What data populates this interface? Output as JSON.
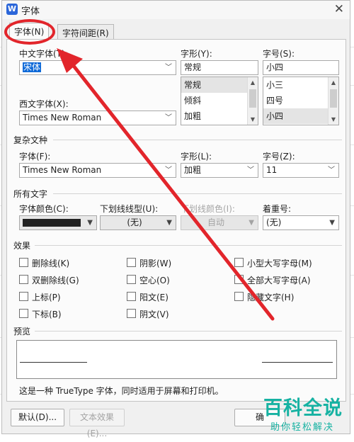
{
  "window": {
    "title": "字体",
    "app_icon_letter": "W",
    "close": "✕"
  },
  "tabs": [
    {
      "label": "字体(N)",
      "active": true
    },
    {
      "label": "字符间距(R)",
      "active": false
    }
  ],
  "chinese_font": {
    "label": "中文字体(T):",
    "value": "宋体"
  },
  "style": {
    "label": "字形(Y):",
    "value": "常规",
    "options": [
      "常规",
      "倾斜",
      "加粗"
    ]
  },
  "size": {
    "label": "字号(S):",
    "value": "小四",
    "options": [
      "小三",
      "四号",
      "小四"
    ]
  },
  "western_font": {
    "label": "西文字体(X):",
    "value": "Times New Roman"
  },
  "complex": {
    "section_label": "复杂文种",
    "font_label": "字体(F):",
    "font_value": "Times New Roman",
    "style_label": "字形(L):",
    "style_value": "加粗",
    "size_label": "字号(Z):",
    "size_value": "11"
  },
  "all_text": {
    "section_label": "所有文字",
    "color_label": "字体颜色(C):",
    "underline_label": "下划线线型(U):",
    "underline_value": "(无)",
    "underline_color_label": "下划线颜色(I):",
    "underline_color_value": "自动",
    "emphasis_label": "着重号:",
    "emphasis_value": "(无)"
  },
  "effects": {
    "section_label": "效果",
    "items": [
      "删除线(K)",
      "双删除线(G)",
      "上标(P)",
      "下标(B)",
      "阴影(W)",
      "空心(O)",
      "阳文(E)",
      "阴文(V)",
      "小型大写字母(M)",
      "全部大写字母(A)",
      "隐藏文字(H)"
    ]
  },
  "preview": {
    "section_label": "预览",
    "note": "这是一种 TrueType 字体，同时适用于屏幕和打印机。"
  },
  "buttons": {
    "default": "默认(D)...",
    "text_effects": "文本效果(E)...",
    "ok": "确"
  },
  "watermark": {
    "main": "百科全说",
    "sub": "助你轻松解决"
  },
  "colors": {
    "annotation": "#e2252b",
    "watermark": "#16b2a2",
    "selection": "#0f6ad8"
  }
}
